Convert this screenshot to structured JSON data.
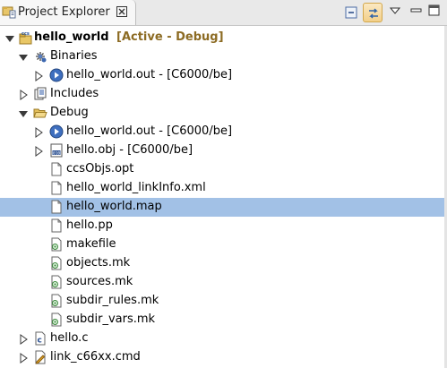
{
  "tab": {
    "title": "Project Explorer",
    "close_glyph": "⊠",
    "icon": "project-explorer-icon"
  },
  "toolbar": {
    "collapse_all_icon": "collapse-all-icon",
    "link_with_editor_icon": "link-with-editor-icon",
    "view_menu_icon": "view-menu-icon",
    "minimize_icon": "minimize-icon",
    "maximize_icon": "maximize-icon"
  },
  "tree": {
    "project": {
      "label": "hello_world",
      "status": "[Active - Debug]",
      "status_color": "#8c6b23"
    },
    "binaries": {
      "label": "Binaries",
      "items": [
        {
          "label": "hello_world.out - [C6000/be]"
        }
      ]
    },
    "includes": {
      "label": "Includes"
    },
    "debug": {
      "label": "Debug",
      "items": [
        {
          "label": "hello_world.out - [C6000/be]"
        },
        {
          "label": "hello.obj - [C6000/be]"
        },
        {
          "label": "ccsObjs.opt"
        },
        {
          "label": "hello_world_linkInfo.xml"
        },
        {
          "label": "hello_world.map"
        },
        {
          "label": "hello.pp"
        },
        {
          "label": "makefile"
        },
        {
          "label": "objects.mk"
        },
        {
          "label": "sources.mk"
        },
        {
          "label": "subdir_rules.mk"
        },
        {
          "label": "subdir_vars.mk"
        }
      ]
    },
    "hello_c": {
      "label": "hello.c"
    },
    "link_cmd": {
      "label": "link_c66xx.cmd"
    },
    "selected_item": "hello_world.map",
    "selection_color": "#a2c1e6"
  }
}
